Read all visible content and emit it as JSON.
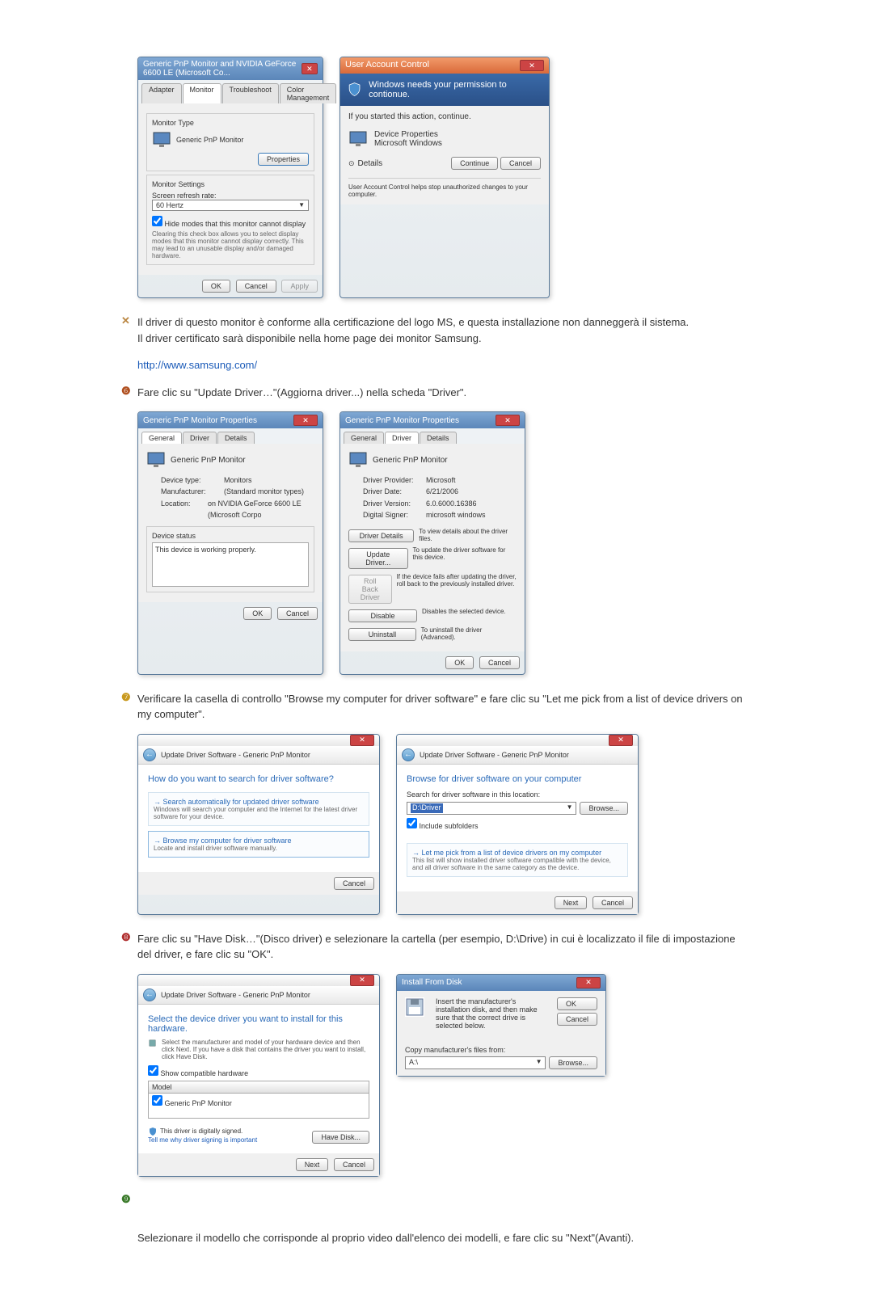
{
  "dialog1": {
    "title": "Generic PnP Monitor and NVIDIA GeForce 6600 LE (Microsoft Co...",
    "tabs": [
      "Adapter",
      "Monitor",
      "Troubleshoot",
      "Color Management"
    ],
    "monitor_type_label": "Monitor Type",
    "monitor_name": "Generic PnP Monitor",
    "properties_btn": "Properties",
    "settings_label": "Monitor Settings",
    "refresh_label": "Screen refresh rate:",
    "refresh_value": "60 Hertz",
    "hide_check": "Hide modes that this monitor cannot display",
    "hide_note": "Clearing this check box allows you to select display modes that this monitor cannot display correctly. This may lead to an unusable display and/or damaged hardware.",
    "ok": "OK",
    "cancel": "Cancel",
    "apply": "Apply"
  },
  "uac": {
    "title": "User Account Control",
    "headline": "Windows needs your permission to contionue.",
    "started": "If you started this action, continue.",
    "device_properties": "Device Properties",
    "ms_windows": "Microsoft Windows",
    "details": "Details",
    "continue": "Continue",
    "cancel": "Cancel",
    "footer": "User Account Control helps stop unauthorized changes to your computer."
  },
  "note5": {
    "line1": "Il driver di questo monitor è conforme alla certificazione del logo MS, e questa installazione non danneggerà il sistema.",
    "line2": "Il driver certificato sarà disponibile nella home page dei monitor Samsung.",
    "link": "http://www.samsung.com/"
  },
  "step6_text": "Fare clic su \"Update Driver…\"(Aggiorna driver...) nella scheda \"Driver\".",
  "props1": {
    "title": "Generic PnP Monitor Properties",
    "tabs": [
      "General",
      "Driver",
      "Details"
    ],
    "name": "Generic PnP Monitor",
    "rows": {
      "device_type_l": "Device type:",
      "device_type_v": "Monitors",
      "manufacturer_l": "Manufacturer:",
      "manufacturer_v": "(Standard monitor types)",
      "location_l": "Location:",
      "location_v": "on NVIDIA GeForce 6600 LE (Microsoft Corpo"
    },
    "status_label": "Device status",
    "status_text": "This device is working properly.",
    "ok": "OK",
    "cancel": "Cancel"
  },
  "props2": {
    "title": "Generic PnP Monitor Properties",
    "tabs": [
      "General",
      "Driver",
      "Details"
    ],
    "name": "Generic PnP Monitor",
    "rows": {
      "provider_l": "Driver Provider:",
      "provider_v": "Microsoft",
      "date_l": "Driver Date:",
      "date_v": "6/21/2006",
      "version_l": "Driver Version:",
      "version_v": "6.0.6000.16386",
      "signer_l": "Digital Signer:",
      "signer_v": "microsoft windows"
    },
    "buttons": {
      "details": "Driver Details",
      "details_t": "To view details about the driver files.",
      "update": "Update Driver...",
      "update_t": "To update the driver software for this device.",
      "rollback": "Roll Back Driver",
      "rollback_t": "If the device fails after updating the driver, roll back to the previously installed driver.",
      "disable": "Disable",
      "disable_t": "Disables the selected device.",
      "uninstall": "Uninstall",
      "uninstall_t": "To uninstall the driver (Advanced)."
    },
    "ok": "OK",
    "cancel": "Cancel"
  },
  "step7_text": "Verificare la casella di controllo \"Browse my computer for driver software\" e fare clic su \"Let me pick from a list of device drivers on my computer\".",
  "wiz1": {
    "crumb": "Update Driver Software - Generic PnP Monitor",
    "question": "How do you want to search for driver software?",
    "opt1_h": "Search automatically for updated driver software",
    "opt1_t": "Windows will search your computer and the Internet for the latest driver software for your device.",
    "opt2_h": "Browse my computer for driver software",
    "opt2_t": "Locate and install driver software manually.",
    "cancel": "Cancel"
  },
  "wiz2": {
    "crumb": "Update Driver Software - Generic PnP Monitor",
    "heading": "Browse for driver software on your computer",
    "search_label": "Search for driver software in this location:",
    "path": "D:\\Driver",
    "browse": "Browse...",
    "include": "Include subfolders",
    "pick_h": "Let me pick from a list of device drivers on my computer",
    "pick_t": "This list will show installed driver software compatible with the device, and all driver software in the same category as the device.",
    "next": "Next",
    "cancel": "Cancel"
  },
  "step8_text": "Fare clic su \"Have Disk…\"(Disco driver) e selezionare la cartella (per esempio, D:\\Drive) in cui è localizzato il file di impostazione del driver, e fare clic su \"OK\".",
  "wiz3": {
    "crumb": "Update Driver Software - Generic PnP Monitor",
    "heading": "Select the device driver you want to install for this hardware.",
    "sub": "Select the manufacturer and model of your hardware device and then click Next. If you have a disk that contains the driver you want to install, click Have Disk.",
    "compat": "Show compatible hardware",
    "model_label": "Model",
    "model_item": "Generic PnP Monitor",
    "signed": "This driver is digitally signed.",
    "why": "Tell me why driver signing is important",
    "have_disk": "Have Disk...",
    "next": "Next",
    "cancel": "Cancel"
  },
  "install_disk": {
    "title": "Install From Disk",
    "text": "Insert the manufacturer's installation disk, and then make sure that the correct drive is selected below.",
    "ok": "OK",
    "cancel": "Cancel",
    "copy_label": "Copy manufacturer's files from:",
    "path": "A:\\",
    "browse": "Browse..."
  },
  "step9_text": "Selezionare il modello che corrisponde al proprio video dall'elenco dei modelli, e fare clic su \"Next\"(Avanti)."
}
